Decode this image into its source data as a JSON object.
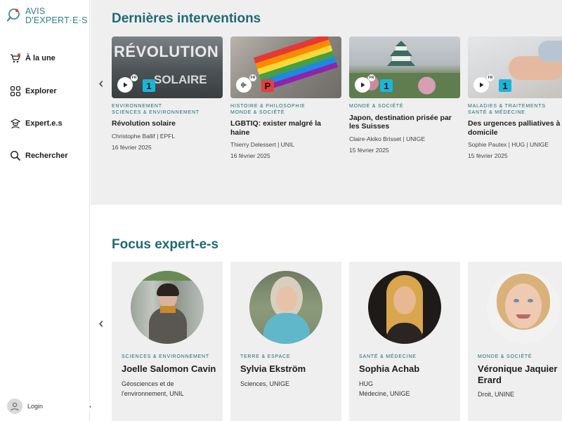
{
  "logo": {
    "line1": "AVIS",
    "line2": "D'EXPERT·E·S"
  },
  "nav": [
    {
      "label": "À la une",
      "icon": "cart-bell-icon"
    },
    {
      "label": "Explorer",
      "icon": "grid-icon"
    },
    {
      "label": "Expert.e.s",
      "icon": "expert-icon"
    },
    {
      "label": "Rechercher",
      "icon": "search-icon"
    }
  ],
  "login": {
    "label": "Login"
  },
  "collapse": {
    "glyph": "‹"
  },
  "sections": {
    "interventions_title": "Dernières interventions",
    "experts_title": "Focus expert-e-s"
  },
  "interventions": [
    {
      "cats": [
        "Environnement",
        "Sciences & environnement"
      ],
      "title": "Révolution solaire",
      "author": "Christophe Ballif | EPFL",
      "date": "16 février 2025",
      "media": "video",
      "lang": "FR",
      "badge": "1",
      "badge_color": "#19b6d9",
      "thumb_text_1": "RÉVOLUTION",
      "thumb_text_2": "SOLAIRE"
    },
    {
      "cats": [
        "Histoire & philosophie",
        "Monde & société"
      ],
      "title": "LGBTIQ: exister malgré la haine",
      "author": "Thierry Delessert | UNIL",
      "date": "16 février 2025",
      "media": "audio",
      "lang": "FR",
      "badge": "P",
      "badge_color": "#e0413f"
    },
    {
      "cats": [
        "Monde & société"
      ],
      "title": "Japon, destination prisée par les Suisses",
      "author": "Claire-Akiko Brisset | UNIGE",
      "date": "15 février 2025",
      "media": "video",
      "lang": "FR",
      "badge": "1",
      "badge_color": "#19b6d9"
    },
    {
      "cats": [
        "Maladies & traitements",
        "Santé & médecine"
      ],
      "title": "Des urgences palliatives à domicile",
      "author": "Sophie Pautex | HUG | UNIGE",
      "date": "15 février 2025",
      "media": "video",
      "lang": "FR",
      "badge": "1",
      "badge_color": "#19b6d9"
    }
  ],
  "experts": [
    {
      "cat": "Sciences & environnement",
      "name": "Joelle Salomon Cavin",
      "desc": [
        "Géosciences et de l'environnement, UNIL"
      ]
    },
    {
      "cat": "Terre & espace",
      "name": "Sylvia Ekström",
      "desc": [
        "Sciences, UNIGE"
      ]
    },
    {
      "cat": "Santé & médecine",
      "name": "Sophia Achab",
      "desc": [
        "HUG",
        "Médecine, UNIGE"
      ]
    },
    {
      "cat": "Monde & société",
      "name": "Véronique Jaquier Erard",
      "desc": [
        "Droit, UNINE"
      ]
    }
  ],
  "colors": {
    "accent": "#1f6a72",
    "logo": "#2b7f86"
  }
}
